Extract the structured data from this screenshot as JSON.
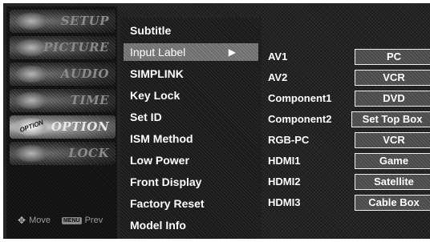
{
  "categories": [
    {
      "label": "SETUP",
      "active": false
    },
    {
      "label": "PICTURE",
      "active": false
    },
    {
      "label": "AUDIO",
      "active": false
    },
    {
      "label": "TIME",
      "active": false
    },
    {
      "label": "OPTION",
      "active": true,
      "thumb_text": "OPTION"
    },
    {
      "label": "LOCK",
      "active": false
    }
  ],
  "hints": {
    "move_label": "Move",
    "menu_key": "MENU",
    "prev_label": "Prev"
  },
  "options": [
    {
      "label": "Subtitle"
    },
    {
      "label": "Input Label",
      "selected": true
    },
    {
      "label": "SIMPLINK"
    },
    {
      "label": "Key Lock"
    },
    {
      "label": "Set ID"
    },
    {
      "label": "ISM Method"
    },
    {
      "label": "Low Power"
    },
    {
      "label": "Front Display"
    },
    {
      "label": "Factory Reset"
    },
    {
      "label": "Model Info"
    }
  ],
  "input_labels": [
    {
      "input": "AV1",
      "value": "PC"
    },
    {
      "input": "AV2",
      "value": "VCR"
    },
    {
      "input": "Component1",
      "value": "DVD"
    },
    {
      "input": "Component2",
      "value": "Set Top Box"
    },
    {
      "input": "RGB-PC",
      "value": "VCR"
    },
    {
      "input": "HDMI1",
      "value": "Game"
    },
    {
      "input": "HDMI2",
      "value": "Satellite"
    },
    {
      "input": "HDMI3",
      "value": "Cable Box"
    }
  ],
  "icons": {
    "move": "four-way-arrow-icon",
    "submenu": "right-triangle-icon"
  }
}
